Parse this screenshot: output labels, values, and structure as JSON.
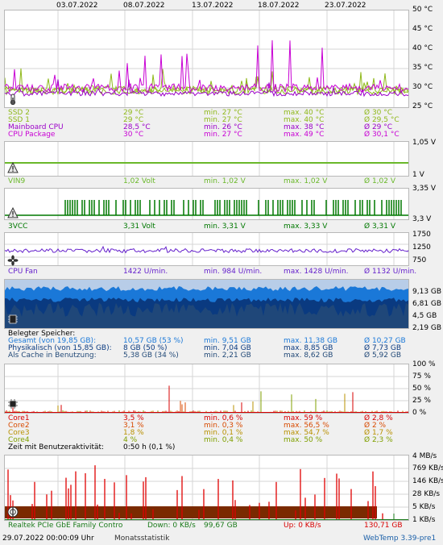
{
  "timeline": {
    "dates": [
      "03.07.2022",
      "08.07.2022",
      "13.07.2022",
      "18.07.2022",
      "23.07.2022"
    ]
  },
  "colors": {
    "ssd2": "#8fb81a",
    "ssd1": "#8fb81a",
    "mainboard": "#9b00c8",
    "cpu_package": "#c800d4",
    "vin9": "#6ab82a",
    "vcc": "#007800",
    "fan": "#6622cc",
    "mem_total": "#1a78d8",
    "mem_phys": "#0a3a80",
    "mem_cache": "#234a78",
    "core1": "#d80000",
    "core2": "#d84a00",
    "core3": "#b89000",
    "core4": "#80a000",
    "net_down": "#e00000",
    "net_up": "#7a2a00",
    "net_total": "#1a7a1a",
    "net_up_text": "#d80000"
  },
  "temperature": {
    "axis": [
      "50 °C",
      "45 °C",
      "40 °C",
      "35 °C",
      "30 °C",
      "25 °C"
    ],
    "icon": "thermometer-icon",
    "rows": [
      {
        "name": "SSD 2",
        "cur": "29 °C",
        "min": "min. 27 °C",
        "max": "max. 40 °C",
        "avg": "Ø 30 °C"
      },
      {
        "name": "SSD 1",
        "cur": "29 °C",
        "min": "min. 27 °C",
        "max": "max. 40 °C",
        "avg": "Ø 29,5 °C"
      },
      {
        "name": "Mainboard CPU",
        "cur": "28,5 °C",
        "min": "min. 26 °C",
        "max": "max. 38 °C",
        "avg": "Ø 29 °C"
      },
      {
        "name": "CPU Package",
        "cur": "30 °C",
        "min": "min. 27 °C",
        "max": "max. 49 °C",
        "avg": "Ø 30,1 °C"
      }
    ]
  },
  "vin9": {
    "axis": [
      "1,05 V",
      "1 V"
    ],
    "icon": "warning-icon",
    "row": {
      "name": "VIN9",
      "cur": "1,02 Volt",
      "min": "min. 1,02 V",
      "max": "max. 1,02 V",
      "avg": "Ø 1,02 V"
    }
  },
  "vcc": {
    "axis": [
      "3,35 V",
      "3,3 V"
    ],
    "icon": "warning-icon",
    "row": {
      "name": "3VCC",
      "cur": "3,31 Volt",
      "min": "min. 3,31 V",
      "max": "max. 3,33 V",
      "avg": "Ø 3,31 V"
    }
  },
  "fan": {
    "axis": [
      "1750",
      "1250",
      "750"
    ],
    "icon": "fan-icon",
    "row": {
      "name": "CPU Fan",
      "cur": "1422 U/min.",
      "min": "min. 984 U/min.",
      "max": "max. 1428 U/min.",
      "avg": "Ø 1132 U/min."
    }
  },
  "memory": {
    "axis": [
      "9,13 GB",
      "6,81 GB",
      "4,5 GB",
      "2,19 GB"
    ],
    "icon": "memory-chip-icon",
    "heading": "Belegter Speicher:",
    "rows": [
      {
        "name": "Gesamt (von 19,85 GB):",
        "cur": "10,57 GB (53 %)",
        "min": "min. 9,51 GB",
        "max": "max. 11,38 GB",
        "avg": "Ø 10,27 GB"
      },
      {
        "name": "Physikalisch (von 15,85 GB):",
        "cur": "8 GB (50 %)",
        "min": "min. 7,04 GB",
        "max": "max. 8,85 GB",
        "avg": "Ø 7,73 GB"
      },
      {
        "name": "Als Cache in Benutzung:",
        "cur": "5,38 GB (34 %)",
        "min": "min. 2,21 GB",
        "max": "max. 8,62 GB",
        "avg": "Ø 5,92 GB"
      }
    ]
  },
  "cpu_load": {
    "axis": [
      "100 %",
      "75 %",
      "50 %",
      "25 %",
      "0 %"
    ],
    "icon": "cpu-chip-icon",
    "rows": [
      {
        "name": "Core1",
        "cur": "3,5 %",
        "min": "min. 0,6 %",
        "max": "max. 59 %",
        "avg": "Ø 2,8 %"
      },
      {
        "name": "Core2",
        "cur": "3,1 %",
        "min": "min. 0,3 %",
        "max": "max. 56,5 %",
        "avg": "Ø 2 %"
      },
      {
        "name": "Core3",
        "cur": "1,8 %",
        "min": "min. 0,1 %",
        "max": "max. 54,7 %",
        "avg": "Ø 1,7 %"
      },
      {
        "name": "Core4",
        "cur": "4 %",
        "min": "min. 0,4 %",
        "max": "max. 50 %",
        "avg": "Ø 2,3 %"
      }
    ],
    "activity_label": "Zeit mit Benutzeraktivität:",
    "activity_value": "0:50 h (0,1 %)"
  },
  "network": {
    "axis": [
      "4 MB/s",
      "769 KB/s",
      "146 KB/s",
      "28 KB/s",
      "5 KB/s",
      "1 KB/s"
    ],
    "icon": "network-adapter-icon",
    "adapter": "Realtek PCIe GbE Family Contro",
    "down": "Down: 0 KB/s",
    "total_down": "99,67 GB",
    "up": "Up: 0 KB/s",
    "total_up": "130,71 GB"
  },
  "footer": {
    "timestamp": "29.07.2022 00:00:09 Uhr",
    "period": "Monatsstatistik",
    "app": "WebTemp 3.39-pre1"
  }
}
